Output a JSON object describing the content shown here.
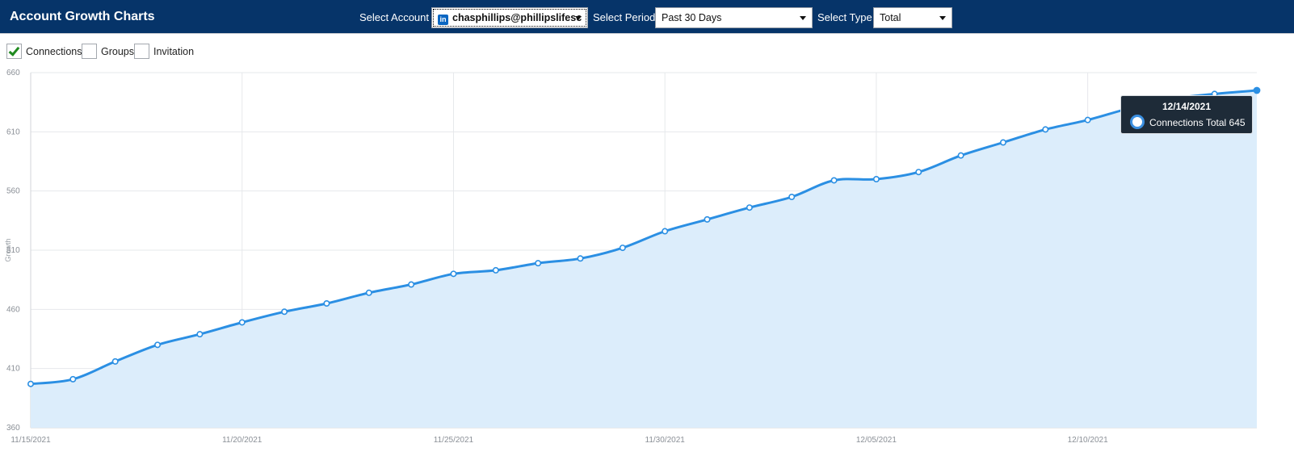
{
  "header": {
    "title": "Account Growth Charts",
    "account_label": "Select Account",
    "account_value": "chasphillips@phillipslifesc",
    "period_label": "Select Period",
    "period_value": "Past 30 Days",
    "type_label": "Select Type",
    "type_value": "Total"
  },
  "toggles": [
    {
      "label": "Connections",
      "checked": true
    },
    {
      "label": "Groups",
      "checked": false
    },
    {
      "label": "Invitation",
      "checked": false
    }
  ],
  "colors": {
    "header_bg": "#063469",
    "line": "#2b8fe3",
    "area": "#dcedfb",
    "check": "#1f8a1f"
  },
  "icons": {
    "account_icon": "linkedin-icon",
    "dropdown_icon": "chevron-down-icon",
    "check_icon": "check-icon"
  },
  "tooltip": {
    "date": "12/14/2021",
    "series": "Connections Total",
    "value": "645"
  },
  "chart_data": {
    "type": "area",
    "ylabel": "Growth",
    "xlabel": "",
    "ylim": [
      360,
      660
    ],
    "yticks": [
      360,
      410,
      460,
      510,
      560,
      610,
      660
    ],
    "xlim": [
      "11/15/2021",
      "12/14/2021"
    ],
    "xtick_labels": [
      "11/15/2021",
      "11/20/2021",
      "11/25/2021",
      "11/30/2021",
      "12/05/2021",
      "12/10/2021"
    ],
    "grid": true,
    "series": [
      {
        "x": [
          "11/15/2021",
          "11/16/2021",
          "11/17/2021",
          "11/18/2021",
          "11/19/2021",
          "11/20/2021",
          "11/21/2021",
          "11/22/2021",
          "11/23/2021",
          "11/24/2021",
          "11/25/2021",
          "11/26/2021",
          "11/27/2021",
          "11/28/2021",
          "11/29/2021",
          "11/30/2021",
          "12/01/2021",
          "12/02/2021",
          "12/03/2021",
          "12/04/2021",
          "12/05/2021",
          "12/06/2021",
          "12/07/2021",
          "12/08/2021",
          "12/09/2021",
          "12/10/2021",
          "12/11/2021",
          "12/12/2021",
          "12/13/2021",
          "12/14/2021"
        ],
        "values": [
          397,
          401,
          416,
          430,
          439,
          449,
          458,
          465,
          474,
          481,
          490,
          493,
          499,
          503,
          512,
          526,
          536,
          546,
          555,
          569,
          570,
          576,
          590,
          601,
          612,
          620,
          630,
          638,
          642,
          645
        ]
      }
    ]
  }
}
